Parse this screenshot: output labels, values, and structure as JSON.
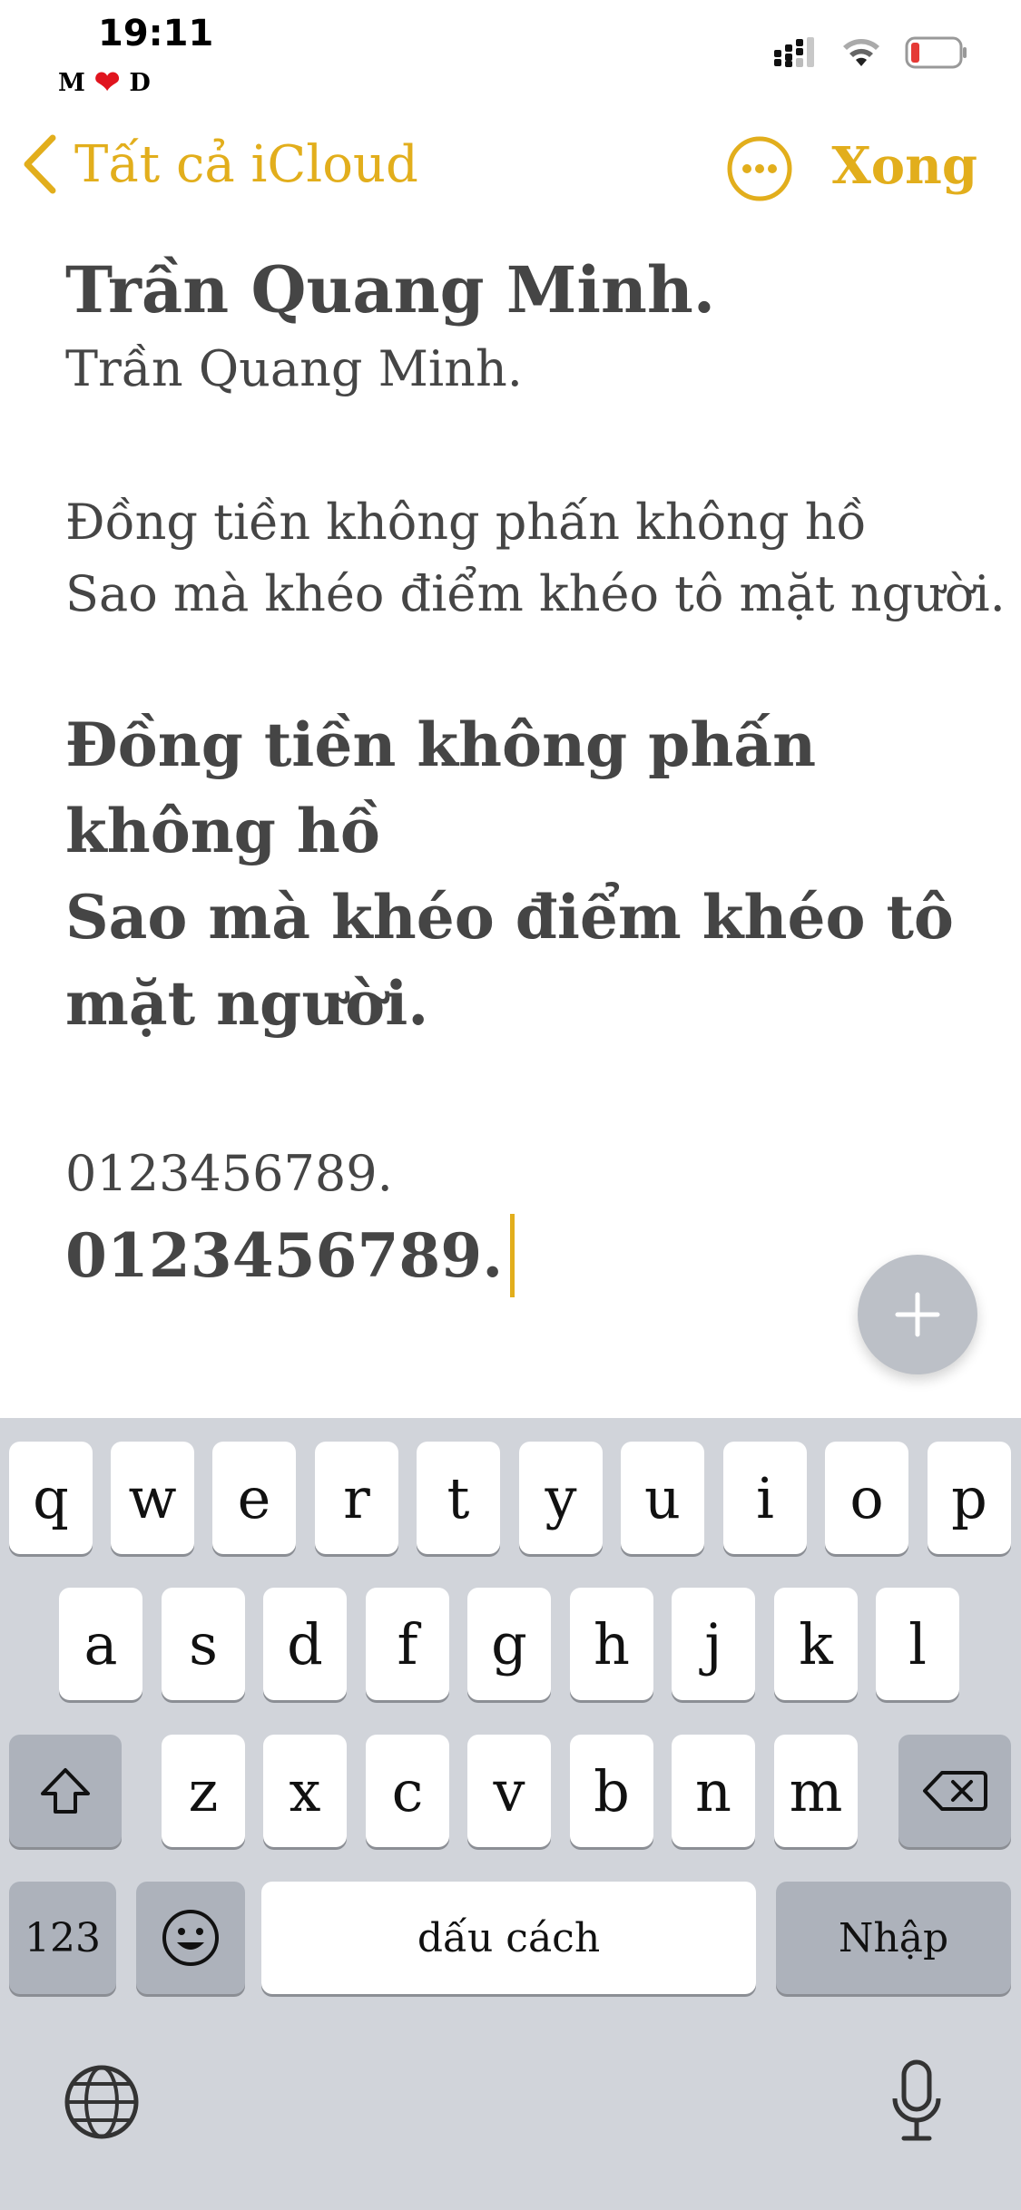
{
  "status_bar": {
    "time": "19:11",
    "carrier_left": "M",
    "carrier_right": "D",
    "heart_icon": "heart-icon",
    "battery_color": "#e53935"
  },
  "nav": {
    "back_label": "Tất cả iCloud",
    "done_label": "Xong",
    "accent_color": "#e2ae1c"
  },
  "note": {
    "title_bold": "Trần Quang Minh.",
    "title_regular": "Trần Quang Minh.",
    "poem_regular": [
      "Đồng tiền không phấn không hồ",
      "Sao mà khéo điểm khéo tô mặt người."
    ],
    "poem_bold": [
      "Đồng tiền không phấn",
      "không hồ",
      "Sao mà khéo điểm khéo tô",
      "mặt người."
    ],
    "number_regular": "0123456789.",
    "number_bold": "0123456789."
  },
  "keyboard": {
    "row1": [
      "q",
      "w",
      "e",
      "r",
      "t",
      "y",
      "u",
      "i",
      "o",
      "p"
    ],
    "row2": [
      "a",
      "s",
      "d",
      "f",
      "g",
      "h",
      "j",
      "k",
      "l"
    ],
    "row3": [
      "z",
      "x",
      "c",
      "v",
      "b",
      "n",
      "m"
    ],
    "numbers_label": "123",
    "space_label": "dấu cách",
    "return_label": "Nhập"
  }
}
